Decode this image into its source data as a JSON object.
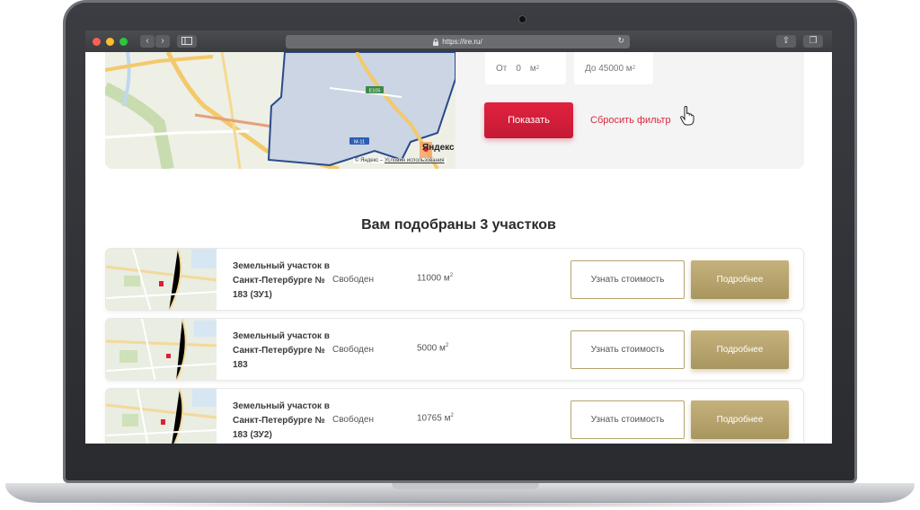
{
  "browser": {
    "url": "https://ire.ru/",
    "lock_icon": "lock-icon",
    "back_label": "‹",
    "forward_label": "›",
    "reload_label": "↻",
    "share_label": "⇪",
    "tabs_label": "❐"
  },
  "filter": {
    "from_label": "От",
    "from_value": "0",
    "from_unit": "м",
    "unit_sup": "2",
    "to_label": "До 45000 м",
    "show_button": "Показать",
    "reset_link": "Сбросить фильтр"
  },
  "map": {
    "brand": "Яндекс",
    "copyright_prefix": "© Яндекс –",
    "copyright_link": "Условия использования",
    "road_label_e105": "E105",
    "road_label_m11": "M-11"
  },
  "results": {
    "title": "Вам подобраны 3 участков",
    "items": [
      {
        "name": "Земельный участок в Санкт-Петербурге № 183 (ЗУ1)",
        "status": "Свободен",
        "area": "11000 м",
        "area_sup": "2",
        "price_button": "Узнать стоимость",
        "details_button": "Подробнее"
      },
      {
        "name": "Земельный участок в Санкт-Петербурге № 183",
        "status": "Свободен",
        "area": "5000 м",
        "area_sup": "2",
        "price_button": "Узнать стоимость",
        "details_button": "Подробнее"
      },
      {
        "name": "Земельный участок в Санкт-Петербурге № 183 (ЗУ2)",
        "status": "Свободен",
        "area": "10765 м",
        "area_sup": "2",
        "price_button": "Узнать стоимость",
        "details_button": "Подробнее"
      }
    ]
  },
  "colors": {
    "accent_red": "#d8263f",
    "accent_gold": "#b5a36e"
  }
}
